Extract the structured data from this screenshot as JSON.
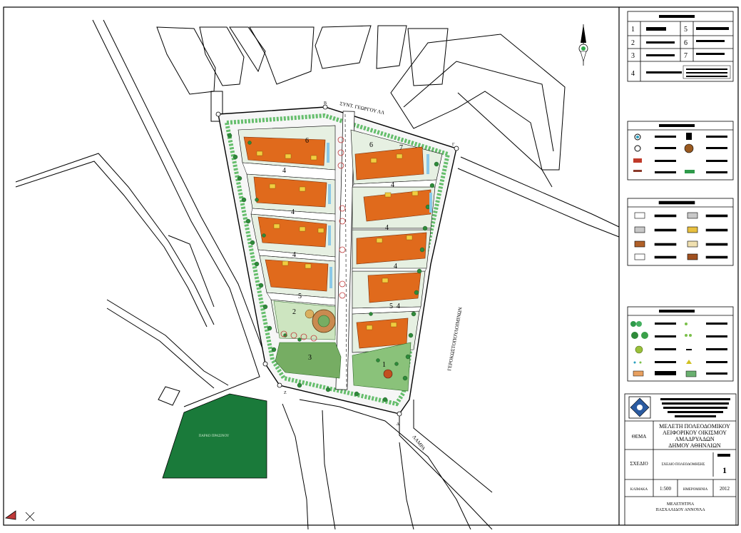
{
  "streets": {
    "top": "ΣΥΝΤ. ΓΕΩΡΓΟΥ ΛΛ",
    "right": "ΓΕΡΟΚΩΣΤΟΠΟΥΛΟΙΜΙΝΩΝ",
    "bottom": "ΛΑΜΡΑ"
  },
  "park_text": "ΠΑΡΚΟ ΠΡΑΣΙΝΟΥ",
  "corner_markers": [
    "Β",
    "Γ",
    "Δ",
    "Ζ"
  ],
  "block_numbers": [
    "6",
    "4",
    "4",
    "4",
    "5",
    "2",
    "3",
    "6",
    "7",
    "4",
    "4",
    "4",
    "4",
    "5",
    "1"
  ],
  "title_block": {
    "thema_label": "ΘΕΜΑ",
    "thema_text": [
      "ΜΕΛΕΤΗ ΠΟΛΕΟΔΟΜΙΚΟΥ",
      "ΑΕΙΦΟΡΙΚΟΥ ΟΙΚΙΣΜΟΥ",
      "ΑΜΑΔΡΥΑΔΩΝ",
      "ΔΗΜΟΥ ΑΘΗΝΑΙΩΝ"
    ],
    "schedio_label": "ΣΧΕΔΙΟ",
    "schedio_text": "ΣΧΕΔΙΟ ΠΟΛΕΟΔΟΜΗΣΗΣ",
    "sheet_number": "1",
    "scale_label": "ΚΛΙΜΑΚΑ",
    "scale_value": "1:500",
    "date_label": "ΗΜΕΡΟΜΗΝΙΑ",
    "date_value": "2012",
    "author_label": "ΜΕΛΕΤΗΤΡΙΑ",
    "author_name": "ΠΑΣΧΑΛΙΔΟΥ ΑΝΝΟΥΛΑ"
  },
  "legend_numbers": [
    "1",
    "2",
    "3",
    "4",
    "5",
    "6",
    "7"
  ]
}
